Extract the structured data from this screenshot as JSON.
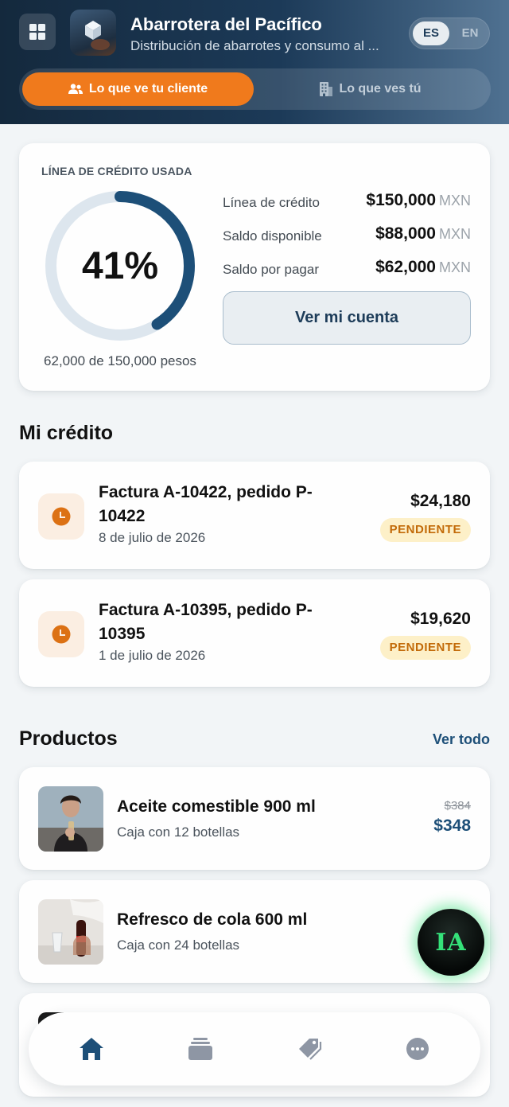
{
  "header": {
    "brand_title": "Abarrotera del Pacífico",
    "brand_subtitle": "Distribución de abarrotes y consumo al ...",
    "lang_es": "ES",
    "lang_en": "EN",
    "active_lang": "ES",
    "view_client": "Lo que ve tu cliente",
    "view_you": "Lo que ves tú",
    "active_view": "client"
  },
  "credit": {
    "label": "LÍNEA DE CRÉDITO USADA",
    "percent_text": "41%",
    "used_fraction": 0.41,
    "caption": "62,000 de 150,000 pesos",
    "rows": [
      {
        "label": "Línea de crédito",
        "amount": "$150,000",
        "currency": "MXN"
      },
      {
        "label": "Saldo disponible",
        "amount": "$88,000",
        "currency": "MXN"
      },
      {
        "label": "Saldo por pagar",
        "amount": "$62,000",
        "currency": "MXN"
      }
    ],
    "account_button": "Ver mi cuenta"
  },
  "my_credit": {
    "title": "Mi crédito",
    "invoices": [
      {
        "title": "Factura A-10422, pedido P-10422",
        "date": "8 de julio de 2026",
        "amount": "$24,180",
        "status": "PENDIENTE"
      },
      {
        "title": "Factura A-10395, pedido P-10395",
        "date": "1 de julio de 2026",
        "amount": "$19,620",
        "status": "PENDIENTE"
      }
    ]
  },
  "products": {
    "title": "Productos",
    "see_all": "Ver todo",
    "items": [
      {
        "name": "Aceite comestible 900 ml",
        "desc": "Caja con 12 botellas",
        "old_price": "$384",
        "price": "$348"
      },
      {
        "name": "Refresco de cola 600 ml",
        "desc": "Caja con 24 botellas"
      }
    ]
  },
  "ia_button": "IA",
  "nav": {
    "active": "home",
    "items": [
      "home-icon",
      "orders-icon",
      "tag-icon",
      "more-icon"
    ]
  },
  "colors": {
    "accent_orange": "#f07a1c",
    "brand_navy": "#1d3c59",
    "price_blue": "#1d4f78",
    "donut_track": "#dde6ee",
    "badge_bg": "#fdf0c8",
    "badge_text": "#c26a08",
    "ia_glow": "#35e27a"
  }
}
